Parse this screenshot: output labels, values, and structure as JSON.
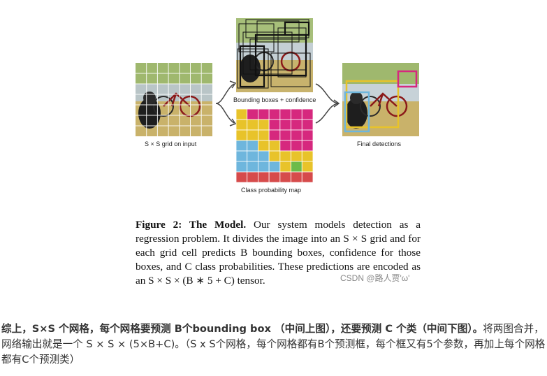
{
  "figure": {
    "left_label": "S × S grid on input",
    "top_label": "Bounding boxes + confidence",
    "bottom_label": "Class probability map",
    "right_label": "Final detections",
    "colors": {
      "magenta": "#d6287e",
      "yellow": "#e8c32a",
      "blue": "#6eb6dd",
      "green": "#6dbb4a",
      "red": "#d64b4b"
    }
  },
  "caption": {
    "lead": "Figure 2: The Model.",
    "text": " Our system models detection as a regression problem. It divides the image into an S × S grid and for each grid cell predicts B bounding boxes, confidence for those boxes, and C class probabilities. These predictions are encoded as an S × S × (B ∗ 5 + C) tensor."
  },
  "watermark": "CSDN @路人贾'ω'",
  "summary": {
    "bold": "综上，S×S 个网格，每个网格要预测 B个bounding box （中间上图），还要预测 C 个类（中间下图）。",
    "rest": "将两图合并，网络输出就是一个 S × S × (5×B+C)。（S x S个网格，每个网格都有B个预测框，每个框又有5个参数，再加上每个网格都有C个预测类）"
  }
}
